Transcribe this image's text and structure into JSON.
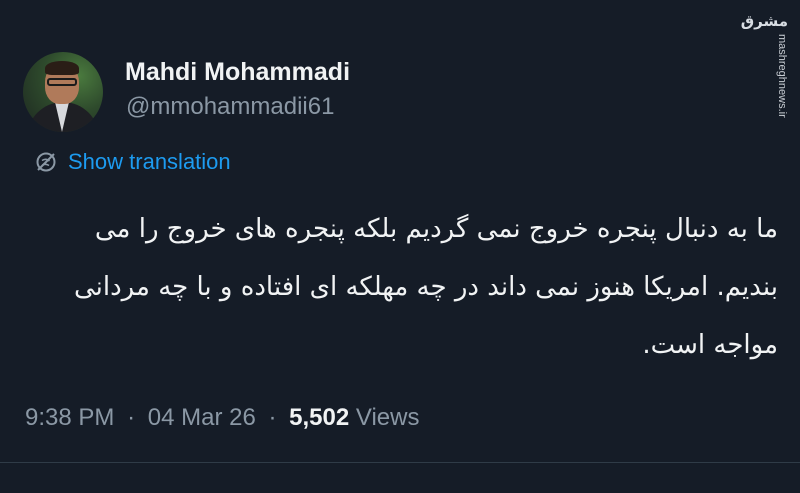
{
  "tweet": {
    "author_name": "Mahdi Mohammadi",
    "author_handle": "@mmohammadii61",
    "translate_label": "Show translation",
    "text": "ما به دنبال پنجره خروج نمی گردیم بلکه پنجره های خروج را می بندیم. امریکا هنوز نمی داند در چه مهلکه ای افتاده و با چه مردانی مواجه است.",
    "time": "9:38 PM",
    "separator": "·",
    "date": "04 Mar 26",
    "views_count": "5,502",
    "views_label": "Views"
  },
  "watermark": {
    "logo_text": "مشرق",
    "url": "mashreghnews.ir"
  },
  "colors": {
    "background": "#151c27",
    "link": "#1d9bf0",
    "muted": "#8b98a5",
    "text": "#f1f3f4"
  },
  "icons": {
    "translate": "globe-slash-icon",
    "avatar": "profile-photo"
  }
}
